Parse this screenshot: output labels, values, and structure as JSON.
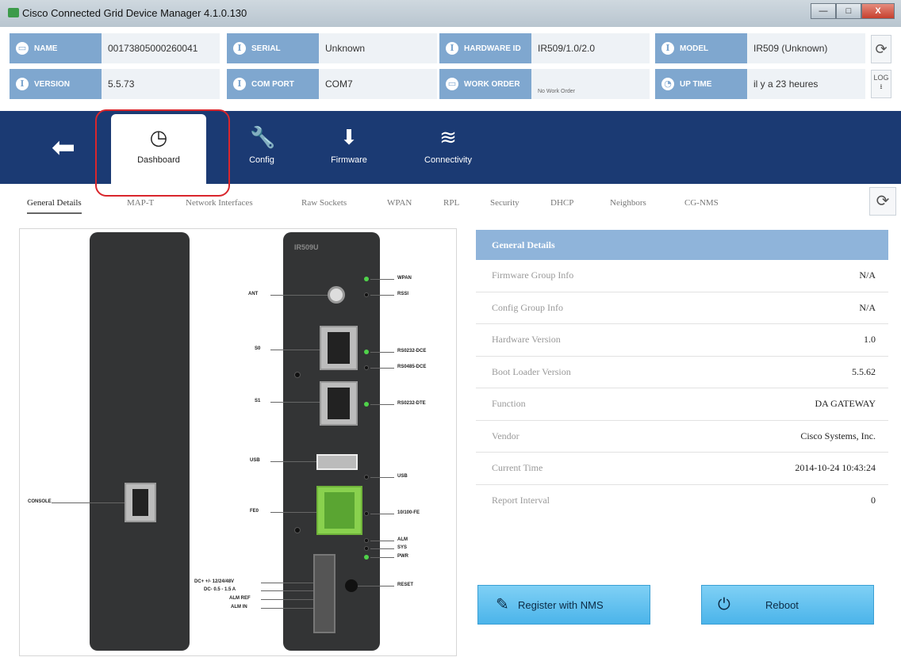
{
  "window": {
    "title": "Cisco Connected Grid Device Manager 4.1.0.130",
    "minimize": "—",
    "maximize": "□",
    "close": "X"
  },
  "info": {
    "name": {
      "label": "Name",
      "icon": "▭",
      "value": "00173805000260041"
    },
    "serial": {
      "label": "Serial",
      "icon": "i",
      "value": "Unknown"
    },
    "hardware": {
      "label": "Hardware ID",
      "icon": "i",
      "value": "IR509/1.0/2.0"
    },
    "model": {
      "label": "Model",
      "icon": "i",
      "value": "IR509 (Unknown)"
    },
    "version": {
      "label": "Version",
      "icon": "i",
      "value": "5.5.73"
    },
    "comport": {
      "label": "Com Port",
      "icon": "i",
      "value": "COM7"
    },
    "workorder": {
      "label": "Work Order",
      "icon": "▭",
      "value": "No Work Order"
    },
    "uptime": {
      "label": "Up Time",
      "icon": "◔",
      "value": "il y a 23 heures"
    },
    "refresh_icon": "⟳",
    "log_label": "LOG",
    "log_icon": "⭳"
  },
  "nav": {
    "back_icon": "⬅",
    "items": [
      {
        "label": "Dashboard",
        "icon": "◷"
      },
      {
        "label": "Config",
        "icon": "🔧"
      },
      {
        "label": "Firmware",
        "icon": "⬇"
      },
      {
        "label": "Connectivity",
        "icon": "≋"
      }
    ]
  },
  "tabs": [
    "General Details",
    "MAP-T",
    "Network Interfaces",
    "Raw Sockets",
    "WPAN",
    "RPL",
    "Security",
    "DHCP",
    "Neighbors",
    "CG-NMS"
  ],
  "device": {
    "model_label": "IR509U",
    "left_labels": {
      "ant": "ANT",
      "s0": "S0",
      "s1": "S1",
      "usb": "USB",
      "fe0": "FE0",
      "console": "CONSOLE"
    },
    "right_labels": {
      "wpan": "WPAN",
      "rssi": "RSSI",
      "rs232dce": "RS0232-DCE",
      "rs485dce": "RS0485-DCE",
      "rs232dte": "RS0232-DTE",
      "usb": "USB",
      "fe": "10/100-FE",
      "alm": "ALM",
      "sys": "SYS",
      "pwr": "PWR",
      "reset": "RESET"
    },
    "power_labels": [
      "DC+ +/- 12/24/48V",
      "DC- 0.5 - 1.5 A",
      "ALM REF",
      "ALM IN"
    ]
  },
  "details": {
    "title": "General Details",
    "rows": [
      {
        "key": "Firmware Group Info",
        "value": "N/A"
      },
      {
        "key": "Config Group Info",
        "value": "N/A"
      },
      {
        "key": "Hardware Version",
        "value": "1.0"
      },
      {
        "key": "Boot Loader Version",
        "value": "5.5.62"
      },
      {
        "key": "Function",
        "value": "DA GATEWAY"
      },
      {
        "key": "Vendor",
        "value": "Cisco Systems, Inc."
      },
      {
        "key": "Current Time",
        "value": "2014-10-24 10:43:24"
      },
      {
        "key": "Report Interval",
        "value": "0"
      }
    ]
  },
  "actions": {
    "register": {
      "label": "Register with NMS",
      "icon": "✎"
    },
    "reboot": {
      "label": "Reboot",
      "icon": "⏻"
    }
  },
  "colors": {
    "nav_bg": "#1b3a73",
    "label_bg": "#7fa7cf",
    "highlight": "#d9262c",
    "button": "#4bb4ea"
  }
}
